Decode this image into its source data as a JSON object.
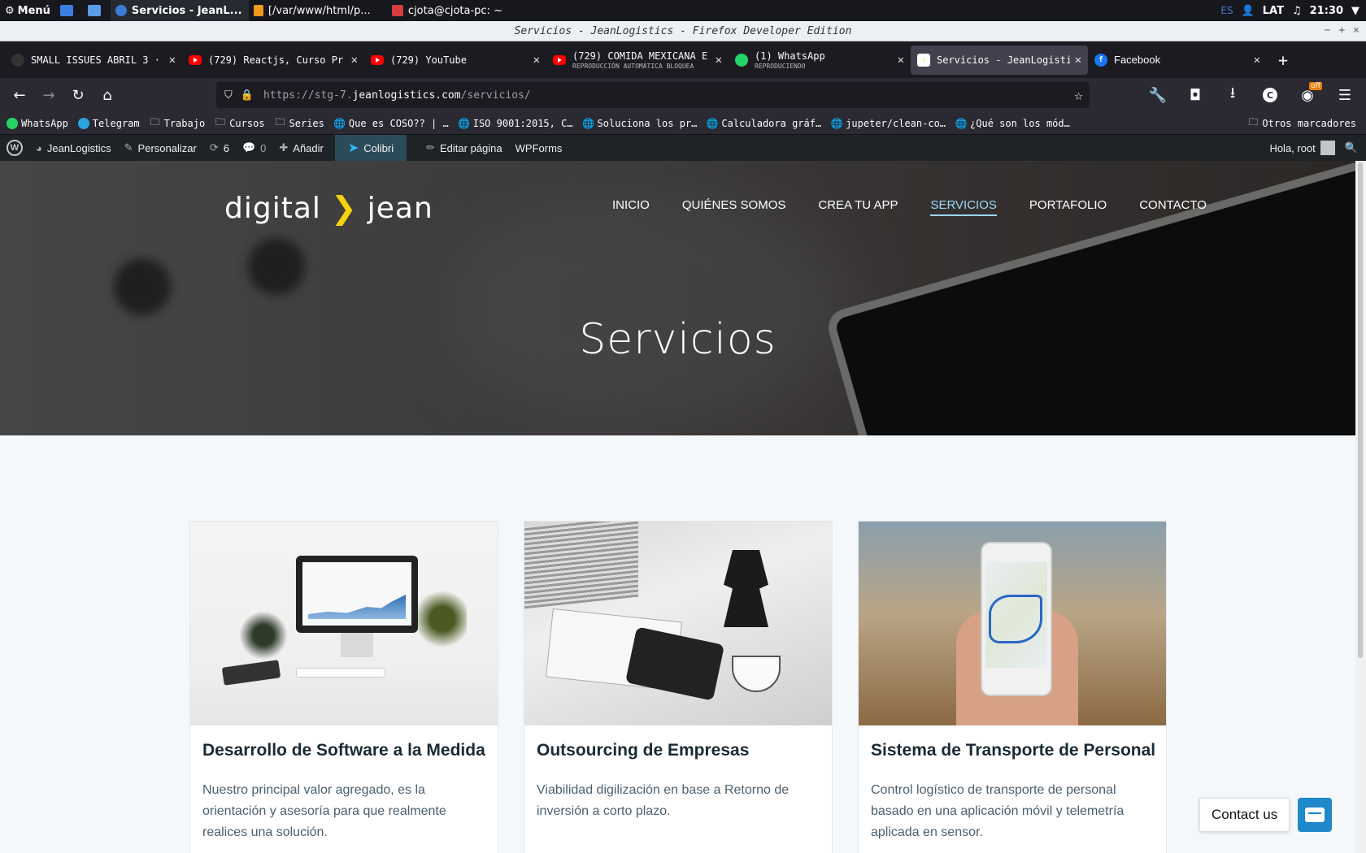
{
  "system": {
    "menu_label": "Menú",
    "tasks": [
      "Servicios - JeanL...",
      "[/var/www/html/p...",
      "cjota@cjota-pc: ~"
    ],
    "lang": "ES",
    "layout": "LAT",
    "time": "21:30"
  },
  "window": {
    "title": "Servicios - JeanLogistics - Firefox Developer Edition",
    "controls": [
      "−",
      "+",
      "×"
    ]
  },
  "tabs": [
    {
      "title": "SMALL ISSUES ABRIL 3 ·",
      "subtitle": "",
      "icon": "jira-icon",
      "active": false
    },
    {
      "title": "(729) Reactjs, Curso Pr",
      "subtitle": "",
      "icon": "youtube-icon",
      "active": false
    },
    {
      "title": "(729) YouTube",
      "subtitle": "",
      "icon": "youtube-icon",
      "active": false
    },
    {
      "title": "(729) COMIDA MEXICANA E",
      "subtitle": "REPRODUCCIÓN AUTOMÁTICA BLOQUEA",
      "icon": "youtube-icon",
      "active": false
    },
    {
      "title": "(1) WhatsApp",
      "subtitle": "REPRODUCIENDO",
      "icon": "whatsapp-icon",
      "active": false
    },
    {
      "title": "Servicios - JeanLogisti",
      "subtitle": "",
      "icon": "jean-icon",
      "active": true
    },
    {
      "title": "Facebook",
      "subtitle": "",
      "icon": "facebook-icon",
      "active": false
    }
  ],
  "nav": {
    "url_prefix": "https://stg-7.",
    "url_domain": "jeanlogistics.com",
    "url_path": "/servicios/",
    "badge": "off"
  },
  "bookmarks": [
    {
      "label": "WhatsApp",
      "icon": "whatsapp-icon"
    },
    {
      "label": "Telegram",
      "icon": "telegram-icon"
    },
    {
      "label": "Trabajo",
      "icon": "folder-icon"
    },
    {
      "label": "Cursos",
      "icon": "folder-icon"
    },
    {
      "label": "Series",
      "icon": "folder-icon"
    },
    {
      "label": "Que es COSO?? | …",
      "icon": "globe-icon"
    },
    {
      "label": "ISO 9001:2015, C…",
      "icon": "globe-icon"
    },
    {
      "label": "Soluciona los pr…",
      "icon": "globe-icon"
    },
    {
      "label": "Calculadora gráf…",
      "icon": "globe-icon"
    },
    {
      "label": "jupeter/clean-co…",
      "icon": "globe-icon"
    },
    {
      "label": "¿Qué son los mód…",
      "icon": "globe-icon"
    }
  ],
  "other_bookmarks": "Otros marcadores",
  "wpadmin": {
    "site": "JeanLogistics",
    "customize": "Personalizar",
    "updates": "6",
    "comments": "0",
    "add": "Añadir",
    "colibri": "Colibri",
    "edit": "Editar página",
    "wpforms": "WPForms",
    "greeting": "Hola, root"
  },
  "site": {
    "logo_left": "digital",
    "logo_right": "jean",
    "menu": [
      "INICIO",
      "QUIÉNES SOMOS",
      "CREA TU APP",
      "SERVICIOS",
      "PORTAFOLIO",
      "CONTACTO"
    ],
    "current": "SERVICIOS",
    "hero_title": "Servicios"
  },
  "cards": [
    {
      "title": "Desarrollo de Software a la Medida",
      "text": "Nuestro principal valor agregado, es la orientación y asesoría para que realmente realices una solución."
    },
    {
      "title": "Outsourcing de Empresas",
      "text": "Viabilidad digilización en base a Retorno de inversión a corto plazo."
    },
    {
      "title": "Sistema de Transporte de Personal",
      "text": "Control logístico de transporte de personal basado en una aplicación móvil y telemetría aplicada en sensor."
    }
  ],
  "contact": {
    "label": "Contact us"
  },
  "colors": {
    "accent": "#9cd6f5",
    "logo_chevron": "#f5d30c",
    "chat_button": "#1e88c9",
    "wp_highlight": "#2c4b58"
  }
}
